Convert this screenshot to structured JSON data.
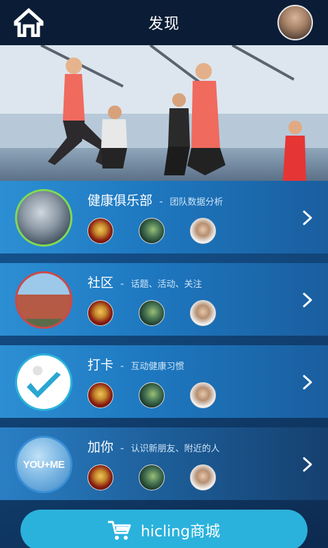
{
  "header": {
    "title": "发现",
    "home_icon": "home-icon",
    "avatar_icon": "user-avatar"
  },
  "banner": {
    "image": "fitness-class-photo"
  },
  "rows": [
    {
      "title": "健康俱乐部",
      "sep": "-",
      "subtitle": "团队数据分析",
      "icon": "club-photo",
      "ring": "#7ed957"
    },
    {
      "title": "社区",
      "sep": "-",
      "subtitle": "话题、活动、关注",
      "icon": "house-photo",
      "ring": "#c94a4a"
    },
    {
      "title": "打卡",
      "sep": "-",
      "subtitle": "互动健康习惯",
      "icon": "checkmark-photo",
      "ring": "#2bb2dc"
    },
    {
      "title": "加你",
      "sep": "-",
      "subtitle": "认识新朋友、附近的人",
      "icon": "you-plus-me-photo",
      "ring": "#3a8fd6",
      "badge": "YOU+ME"
    }
  ],
  "shop": {
    "label": "hicling商城",
    "icon": "cart-icon"
  }
}
